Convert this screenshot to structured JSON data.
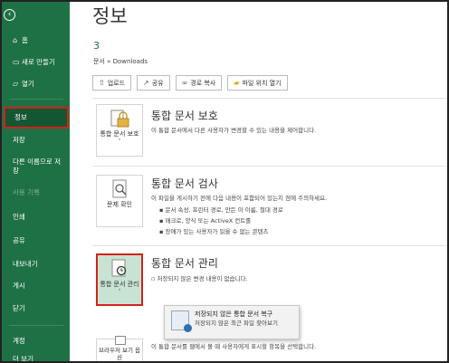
{
  "sidebar": {
    "back_icon": "back-arrow-icon",
    "items": [
      {
        "label": "홈",
        "icon": "home-icon"
      },
      {
        "label": "새로 만들기",
        "icon": "new-doc-icon"
      },
      {
        "label": "열기",
        "icon": "open-folder-icon"
      },
      {
        "label": "정보"
      },
      {
        "label": "저장"
      },
      {
        "label": "다른 이름으로 저장"
      },
      {
        "label": "사용 기록"
      },
      {
        "label": "인쇄"
      },
      {
        "label": "공유"
      },
      {
        "label": "내보내기"
      },
      {
        "label": "게시"
      },
      {
        "label": "닫기"
      },
      {
        "label": "계정"
      },
      {
        "label": "더 보기"
      }
    ]
  },
  "main": {
    "title": "정보",
    "file_name": "3",
    "path": "문서 » Downloads",
    "toolbar": [
      {
        "label": "업로드",
        "icon": "upload-icon"
      },
      {
        "label": "공유",
        "icon": "share-icon"
      },
      {
        "label": "경로 복사",
        "icon": "link-icon"
      },
      {
        "label": "파일 위치 열기",
        "icon": "folder-icon"
      }
    ],
    "protect": {
      "tile_label": "통합 문서 보호",
      "title": "통합 문서 보호",
      "desc": "이 통합 문서에서 다른 사용자가 변경할 수 있는 내용을 제어합니다."
    },
    "inspect": {
      "tile_label": "문제 확인",
      "title": "통합 문서 검사",
      "desc": "이 파일을 게시하기 전에 다음 내용이 포함되어 있는지 점에 주의하세요.",
      "bullets": [
        "문서 속성, 프린터 경로, 만든 이 이름, 절대 경로",
        "매크로, 양식 또는 ActiveX 컨트롤",
        "장애가 있는 사용자가 읽을 수 없는 콘텐츠"
      ]
    },
    "manage": {
      "tile_label": "통합 문서 관리",
      "title": "통합 문서 관리",
      "desc": "저장되지 않은 변경 내용이 없습니다."
    },
    "browser": {
      "title_fragment": "션",
      "desc": "이 통합 문서를 웹에서 볼 때 사용자에게 표시할 항목을 선택합니다.",
      "tile_label": "브라우저 보기 옵션"
    },
    "dropdown": {
      "title": "저장되지 않은 통합 문서 복구",
      "sub": "저장되지 않은 최근 파일 찾아보기"
    }
  }
}
